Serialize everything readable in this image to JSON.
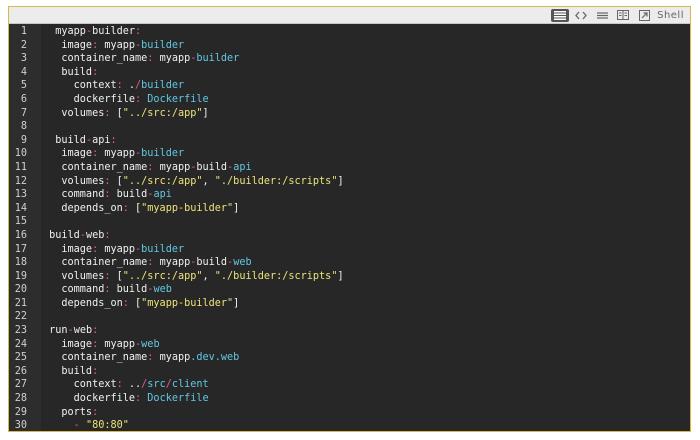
{
  "toolbar": {
    "icons": [
      "list-icon",
      "code-brackets-icon",
      "exchange-icon",
      "columns-icon",
      "external-link-icon"
    ],
    "shell_label": "Shell"
  },
  "editor": {
    "language": "yaml",
    "colors": {
      "background": "#272727",
      "key": "#f0f0f0",
      "punct": "#e35c8c",
      "value": "#61c7e3",
      "string": "#ece37a"
    },
    "lines": [
      {
        "n": "1",
        "t": [
          [
            "k",
            "  myapp"
          ],
          [
            "p",
            "-"
          ],
          [
            "k",
            "builder"
          ],
          [
            "p",
            ":"
          ]
        ]
      },
      {
        "n": "2",
        "t": [
          [
            "k",
            "   image"
          ],
          [
            "p",
            ":"
          ],
          [
            "w",
            " "
          ],
          [
            "k",
            "myapp"
          ],
          [
            "p",
            "-"
          ],
          [
            "v",
            "builder"
          ]
        ]
      },
      {
        "n": "3",
        "t": [
          [
            "k",
            "   container_name"
          ],
          [
            "p",
            ":"
          ],
          [
            "w",
            " "
          ],
          [
            "k",
            "myapp"
          ],
          [
            "p",
            "-"
          ],
          [
            "v",
            "builder"
          ]
        ]
      },
      {
        "n": "4",
        "t": [
          [
            "k",
            "   build"
          ],
          [
            "p",
            ":"
          ]
        ]
      },
      {
        "n": "5",
        "t": [
          [
            "k",
            "     context"
          ],
          [
            "p",
            ":"
          ],
          [
            "w",
            " ."
          ],
          [
            "p",
            "/"
          ],
          [
            "v",
            "builder"
          ]
        ]
      },
      {
        "n": "6",
        "t": [
          [
            "k",
            "     dockerfile"
          ],
          [
            "p",
            ":"
          ],
          [
            "w",
            " "
          ],
          [
            "v",
            "Dockerfile"
          ]
        ]
      },
      {
        "n": "7",
        "t": [
          [
            "k",
            "   volumes"
          ],
          [
            "p",
            ":"
          ],
          [
            "w",
            " ["
          ],
          [
            "s",
            "\"../src:/app\""
          ],
          [
            "w",
            "]"
          ]
        ]
      },
      {
        "n": "8",
        "t": []
      },
      {
        "n": "9",
        "t": [
          [
            "k",
            "  build"
          ],
          [
            "p",
            "-"
          ],
          [
            "k",
            "api"
          ],
          [
            "p",
            ":"
          ]
        ]
      },
      {
        "n": "10",
        "t": [
          [
            "k",
            "   image"
          ],
          [
            "p",
            ":"
          ],
          [
            "w",
            " "
          ],
          [
            "k",
            "myapp"
          ],
          [
            "p",
            "-"
          ],
          [
            "v",
            "builder"
          ]
        ]
      },
      {
        "n": "11",
        "t": [
          [
            "k",
            "   container_name"
          ],
          [
            "p",
            ":"
          ],
          [
            "w",
            " "
          ],
          [
            "k",
            "myapp"
          ],
          [
            "p",
            "-"
          ],
          [
            "k",
            "build"
          ],
          [
            "p",
            "-"
          ],
          [
            "v",
            "api"
          ]
        ]
      },
      {
        "n": "12",
        "t": [
          [
            "k",
            "   volumes"
          ],
          [
            "p",
            ":"
          ],
          [
            "w",
            " ["
          ],
          [
            "s",
            "\"../src:/app\""
          ],
          [
            "w",
            ", "
          ],
          [
            "s",
            "\"./builder:/scripts\""
          ],
          [
            "w",
            "]"
          ]
        ]
      },
      {
        "n": "13",
        "t": [
          [
            "k",
            "   command"
          ],
          [
            "p",
            ":"
          ],
          [
            "w",
            " "
          ],
          [
            "k",
            "build"
          ],
          [
            "p",
            "-"
          ],
          [
            "v",
            "api"
          ]
        ]
      },
      {
        "n": "14",
        "t": [
          [
            "k",
            "   depends_on"
          ],
          [
            "p",
            ":"
          ],
          [
            "w",
            " ["
          ],
          [
            "s",
            "\"myapp-builder\""
          ],
          [
            "w",
            "]"
          ]
        ]
      },
      {
        "n": "15",
        "t": []
      },
      {
        "n": "16",
        "t": [
          [
            "k",
            " build"
          ],
          [
            "p",
            "-"
          ],
          [
            "k",
            "web"
          ],
          [
            "p",
            ":"
          ]
        ]
      },
      {
        "n": "17",
        "t": [
          [
            "k",
            "   image"
          ],
          [
            "p",
            ":"
          ],
          [
            "w",
            " "
          ],
          [
            "k",
            "myapp"
          ],
          [
            "p",
            "-"
          ],
          [
            "v",
            "builder"
          ]
        ]
      },
      {
        "n": "18",
        "t": [
          [
            "k",
            "   container_name"
          ],
          [
            "p",
            ":"
          ],
          [
            "w",
            " "
          ],
          [
            "k",
            "myapp"
          ],
          [
            "p",
            "-"
          ],
          [
            "k",
            "build"
          ],
          [
            "p",
            "-"
          ],
          [
            "v",
            "web"
          ]
        ]
      },
      {
        "n": "19",
        "t": [
          [
            "k",
            "   volumes"
          ],
          [
            "p",
            ":"
          ],
          [
            "w",
            " ["
          ],
          [
            "s",
            "\"../src:/app\""
          ],
          [
            "w",
            ", "
          ],
          [
            "s",
            "\"./builder:/scripts\""
          ],
          [
            "w",
            "]"
          ]
        ]
      },
      {
        "n": "20",
        "t": [
          [
            "k",
            "   command"
          ],
          [
            "p",
            ":"
          ],
          [
            "w",
            " "
          ],
          [
            "k",
            "build"
          ],
          [
            "p",
            "-"
          ],
          [
            "v",
            "web"
          ]
        ]
      },
      {
        "n": "21",
        "t": [
          [
            "k",
            "   depends_on"
          ],
          [
            "p",
            ":"
          ],
          [
            "w",
            " ["
          ],
          [
            "s",
            "\"myapp-builder\""
          ],
          [
            "w",
            "]"
          ]
        ]
      },
      {
        "n": "22",
        "t": []
      },
      {
        "n": "23",
        "t": [
          [
            "k",
            " run"
          ],
          [
            "p",
            "-"
          ],
          [
            "k",
            "web"
          ],
          [
            "p",
            ":"
          ]
        ]
      },
      {
        "n": "24",
        "t": [
          [
            "k",
            "   image"
          ],
          [
            "p",
            ":"
          ],
          [
            "w",
            " "
          ],
          [
            "k",
            "myapp"
          ],
          [
            "p",
            "-"
          ],
          [
            "v",
            "web"
          ]
        ]
      },
      {
        "n": "25",
        "t": [
          [
            "k",
            "   container_name"
          ],
          [
            "p",
            ":"
          ],
          [
            "w",
            " "
          ],
          [
            "k",
            "myapp"
          ],
          [
            "v",
            ".dev.web"
          ]
        ]
      },
      {
        "n": "26",
        "t": [
          [
            "k",
            "   build"
          ],
          [
            "p",
            ":"
          ]
        ]
      },
      {
        "n": "27",
        "t": [
          [
            "k",
            "     context"
          ],
          [
            "p",
            ":"
          ],
          [
            "w",
            " .."
          ],
          [
            "p",
            "/"
          ],
          [
            "v",
            "src"
          ],
          [
            "p",
            "/"
          ],
          [
            "v",
            "client"
          ]
        ]
      },
      {
        "n": "28",
        "t": [
          [
            "k",
            "     dockerfile"
          ],
          [
            "p",
            ":"
          ],
          [
            "w",
            " "
          ],
          [
            "v",
            "Dockerfile"
          ]
        ]
      },
      {
        "n": "29",
        "t": [
          [
            "k",
            "   ports"
          ],
          [
            "p",
            ":"
          ]
        ]
      },
      {
        "n": "30",
        "t": [
          [
            "w",
            "     "
          ],
          [
            "p",
            "-"
          ],
          [
            "w",
            " "
          ],
          [
            "s",
            "\"80:80\""
          ]
        ]
      }
    ]
  }
}
